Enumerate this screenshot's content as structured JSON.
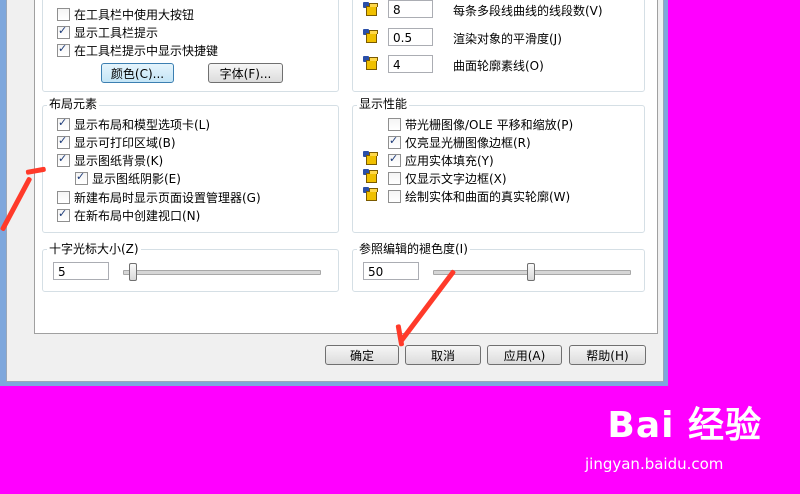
{
  "top_left": {
    "checkboxes": [
      {
        "label": "在工具栏中使用大按钮",
        "checked": false
      },
      {
        "label": "显示工具栏提示",
        "checked": true
      },
      {
        "label": "在工具栏提示中显示快捷键",
        "checked": true
      }
    ],
    "color_button": "颜色(C)...",
    "font_button": "字体(F)..."
  },
  "top_right": {
    "rows": [
      {
        "value": "8",
        "label": "每条多段线曲线的线段数(V)"
      },
      {
        "value": "0.5",
        "label": "渲染对象的平滑度(J)"
      },
      {
        "value": "4",
        "label": "曲面轮廓素线(O)"
      }
    ]
  },
  "layout_elements": {
    "title": "布局元素",
    "items": [
      {
        "label": "显示布局和模型选项卡(L)",
        "checked": true
      },
      {
        "label": "显示可打印区域(B)",
        "checked": true
      },
      {
        "label": "显示图纸背景(K)",
        "checked": true
      },
      {
        "label": "显示图纸阴影(E)",
        "checked": true
      },
      {
        "label": "新建布局时显示页面设置管理器(G)",
        "checked": false
      },
      {
        "label": "在新布局中创建视口(N)",
        "checked": true
      }
    ]
  },
  "display_performance": {
    "title": "显示性能",
    "items": [
      {
        "label": "带光栅图像/OLE 平移和缩放(P)",
        "checked": false
      },
      {
        "label": "仅亮显光栅图像边框(R)",
        "checked": true
      },
      {
        "label": "应用实体填充(Y)",
        "checked": true
      },
      {
        "label": "仅显示文字边框(X)",
        "checked": false
      },
      {
        "label": "绘制实体和曲面的真实轮廓(W)",
        "checked": false
      }
    ]
  },
  "crosshair": {
    "title": "十字光标大小(Z)",
    "value": "5",
    "slider_fraction": 0.05
  },
  "xref_fade": {
    "title": "参照编辑的褪色度(I)",
    "value": "50",
    "slider_fraction": 0.5
  },
  "buttons": {
    "ok": "确定",
    "cancel": "取消",
    "apply": "应用(A)",
    "help": "帮助(H)"
  },
  "watermark": {
    "logo": "Bai 经验",
    "url": "jingyan.baidu.com"
  },
  "colors": {
    "background": "#ff00ff",
    "annotation_arrow": "#ff3a2a"
  }
}
